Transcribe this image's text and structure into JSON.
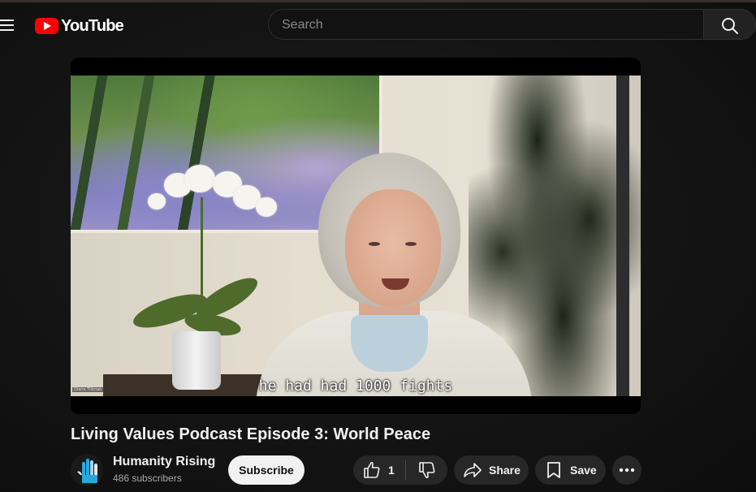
{
  "header": {
    "logo_text": "YouTube",
    "search_placeholder": "Search"
  },
  "player": {
    "caption": "he had had 1000 fights",
    "watermark": "Diane Tillman"
  },
  "video": {
    "title": "Living Values Podcast Episode 3: World Peace"
  },
  "channel": {
    "name": "Humanity Rising",
    "subscribers": "486 subscribers",
    "subscribe_label": "Subscribe"
  },
  "actions": {
    "like_count": "1",
    "share_label": "Share",
    "save_label": "Save"
  },
  "colors": {
    "brand_red": "#ff0000",
    "background": "#0f0f0f",
    "pill": "#272727"
  },
  "icons": [
    "menu-icon",
    "youtube-logo-icon",
    "search-icon",
    "thumbs-up-icon",
    "thumbs-down-icon",
    "share-icon",
    "bookmark-icon",
    "more-icon"
  ]
}
